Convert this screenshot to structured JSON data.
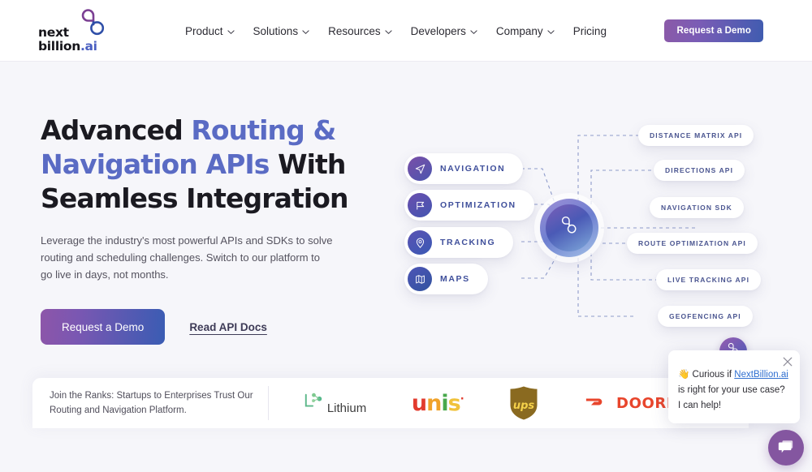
{
  "header": {
    "logo": {
      "line1": "next",
      "line2": "billion",
      "suffix": ".ai",
      "icon": "nextbillion-infinity-logo"
    },
    "nav": [
      {
        "label": "Product",
        "has_dropdown": true
      },
      {
        "label": "Solutions",
        "has_dropdown": true
      },
      {
        "label": "Resources",
        "has_dropdown": true
      },
      {
        "label": "Developers",
        "has_dropdown": true
      },
      {
        "label": "Company",
        "has_dropdown": true
      },
      {
        "label": "Pricing",
        "has_dropdown": false
      }
    ],
    "cta_label": "Request a Demo"
  },
  "hero": {
    "headline_part1": "Advanced ",
    "headline_accent1": "Routing & Navigation APIs",
    "headline_part2": " With Seamless Integration",
    "subcopy": "Leverage the industry's most powerful APIs and SDKs to solve routing and scheduling challenges. Switch to our platform to go live in days, not months.",
    "primary_cta": "Request a Demo",
    "secondary_cta": "Read API Docs"
  },
  "diagram": {
    "hub_icon": "nextbillion-infinity-logo",
    "capabilities": [
      {
        "label": "NAVIGATION",
        "icon": "paper-plane-icon"
      },
      {
        "label": "OPTIMIZATION",
        "icon": "flag-icon"
      },
      {
        "label": "TRACKING",
        "icon": "location-pin-icon"
      },
      {
        "label": "MAPS",
        "icon": "folded-map-icon"
      }
    ],
    "products": [
      {
        "label": "DISTANCE MATRIX API"
      },
      {
        "label": "DIRECTIONS API"
      },
      {
        "label": "NAVIGATION SDK"
      },
      {
        "label": "ROUTE OPTIMIZATION API"
      },
      {
        "label": "LIVE TRACKING API"
      },
      {
        "label": "GEOFENCING API"
      }
    ]
  },
  "logo_strip": {
    "text": "Join the Ranks: Startups to Enterprises Trust Our Routing and Navigation Platform.",
    "logos": [
      {
        "name": "Lithium",
        "word": "Lithium"
      },
      {
        "name": "unis",
        "u": "u",
        "n": "n",
        "i": "i",
        "s": "s",
        "dot": "·"
      },
      {
        "name": "UPS",
        "word": "ups"
      },
      {
        "name": "DoorDash",
        "word": "DOORDASH"
      }
    ]
  },
  "chat": {
    "emoji": "👋",
    "text_before": " Curious if ",
    "link": "NextBillion.ai",
    "text_after": " is right for your use case? I can help!",
    "close_icon": "close-icon",
    "avatar_icon": "nextbillion-infinity-logo",
    "launcher_icon": "chat-bubble-icon"
  },
  "colors": {
    "accent_purple": "#8456a0",
    "accent_blue": "#3a5cb3",
    "headline_accent": "#5a6bc4",
    "page_bg": "#f6f6fa"
  }
}
